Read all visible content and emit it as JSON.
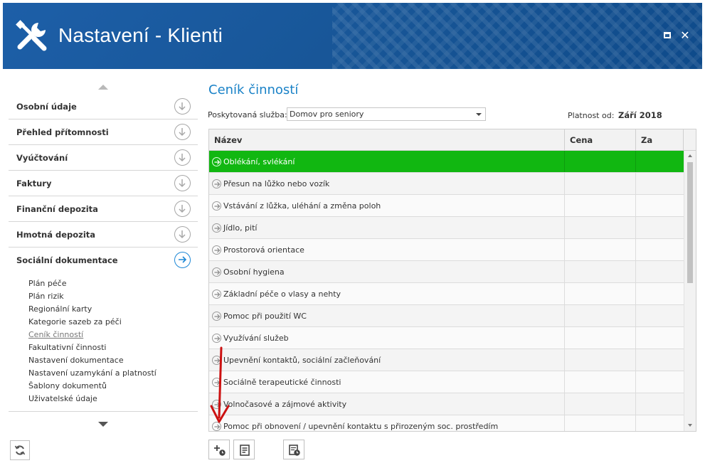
{
  "window": {
    "title": "Nastavení - Klienti",
    "maximize_glyph": "",
    "close_glyph": "✕"
  },
  "colors": {
    "header_blue": "#175596",
    "accent_blue": "#1a82c7",
    "selected_green": "#11b711"
  },
  "icons": {
    "app": "wrench-screwdriver-icon",
    "nav_item": "circle-arrow-down-icon",
    "nav_item_active": "circle-arrow-right-icon",
    "row": "circle-arrow-right-icon",
    "refresh": "refresh-icon",
    "add": "add-with-clock-icon",
    "document": "document-icon",
    "schedule": "schedule-icon"
  },
  "sidebar": {
    "items": [
      {
        "label": "Osobní údaje"
      },
      {
        "label": "Přehled přítomnosti"
      },
      {
        "label": "Vyúčtování"
      },
      {
        "label": "Faktury"
      },
      {
        "label": "Finanční depozita"
      },
      {
        "label": "Hmotná depozita"
      },
      {
        "label": "Sociální dokumentace"
      }
    ],
    "subitems": [
      {
        "label": "Plán péče"
      },
      {
        "label": "Plán rizik"
      },
      {
        "label": "Regionální karty"
      },
      {
        "label": "Kategorie sazeb za péči"
      },
      {
        "label": "Ceník činností"
      },
      {
        "label": "Fakultativní činnosti"
      },
      {
        "label": "Nastavení dokumentace"
      },
      {
        "label": "Nastavení uzamykání a platností"
      },
      {
        "label": "Šablony dokumentů"
      },
      {
        "label": "Uživatelské údaje"
      }
    ]
  },
  "main": {
    "title": "Ceník činností",
    "service_label": "Poskytovaná služba:",
    "service_value": "Domov pro seniory",
    "validity_label": "Platnost od:",
    "validity_value": "Září 2018",
    "columns": [
      "Název",
      "Cena",
      "Za"
    ],
    "rows": [
      {
        "name": "Oblékání, svlékání",
        "price": "",
        "per": ""
      },
      {
        "name": "Přesun na lůžko nebo vozík",
        "price": "",
        "per": ""
      },
      {
        "name": "Vstávání z lůžka, uléhání a změna poloh",
        "price": "",
        "per": ""
      },
      {
        "name": "Jídlo, pití",
        "price": "",
        "per": ""
      },
      {
        "name": "Prostorová orientace",
        "price": "",
        "per": ""
      },
      {
        "name": "Osobní hygiena",
        "price": "",
        "per": ""
      },
      {
        "name": "Základní péče o vlasy a nehty",
        "price": "",
        "per": ""
      },
      {
        "name": "Pomoc při použití WC",
        "price": "",
        "per": ""
      },
      {
        "name": "Využívání služeb",
        "price": "",
        "per": ""
      },
      {
        "name": "Upevnění kontaktů, sociální začleňování",
        "price": "",
        "per": ""
      },
      {
        "name": "Sociálně terapeutické činnosti",
        "price": "",
        "per": ""
      },
      {
        "name": "Volnočasové a zájmové aktivity",
        "price": "",
        "per": ""
      },
      {
        "name": "Pomoc při obnovení / upevnění kontaktu s přirozeným soc. prostředím",
        "price": "",
        "per": ""
      }
    ]
  }
}
